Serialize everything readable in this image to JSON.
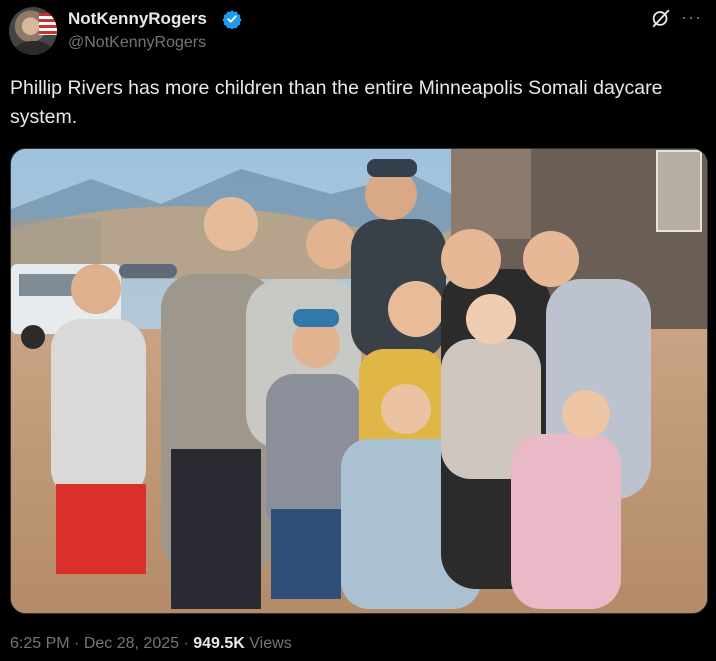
{
  "author": {
    "display_name": "NotKennyRogers",
    "handle": "@NotKennyRogers",
    "verified": true,
    "avatar_icon": "profile-photo"
  },
  "tweet": {
    "text": "Phillip Rivers has more children than the entire Minneapolis Somali daycare system."
  },
  "meta": {
    "time": "6:25 PM",
    "separator": "·",
    "date": "Dec 28, 2025",
    "views_count": "949.5K",
    "views_label": "Views"
  },
  "colors": {
    "background": "#000000",
    "text_primary": "#e7e9ea",
    "text_secondary": "#71767b",
    "verified_badge": "#1d9bf0"
  },
  "icons": {
    "verified": "verified-badge-icon",
    "grok": "grok-icon",
    "more": "more-options-icon"
  }
}
